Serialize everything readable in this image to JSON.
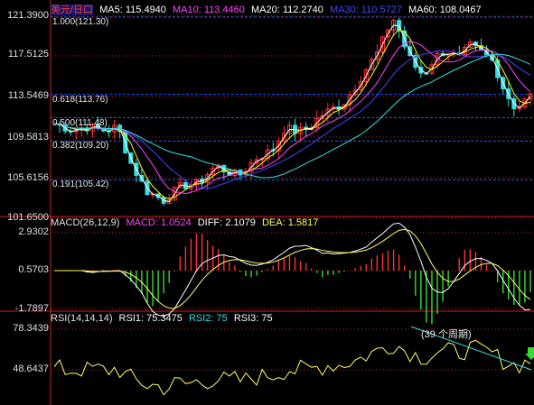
{
  "main_panel": {
    "legend": {
      "symbol": "美元/日口",
      "ma5": "MA5: 115.4940",
      "ma10": "MA10: 113.4460",
      "ma20": "MA20: 112.2740",
      "ma30": "MA30: 110.5727",
      "ma60": "MA60: 108.0467"
    },
    "y_ticks": [
      "121.3900",
      "117.5125",
      "113.5469",
      "109.5813",
      "105.6156",
      "101.6500"
    ],
    "y_tick_values": [
      121.39,
      117.5125,
      113.5469,
      109.5813,
      105.6156,
      101.65
    ],
    "fib_levels": [
      {
        "label": "1.000(121.30)",
        "value": 121.3
      },
      {
        "label": "0.618(113.76)",
        "value": 113.76
      },
      {
        "label": "0.500(111.48)",
        "value": 111.48
      },
      {
        "label": "0.382(109.20)",
        "value": 109.2
      },
      {
        "label": "0.191(105.42)",
        "value": 105.42
      }
    ]
  },
  "macd_panel": {
    "legend": {
      "name": "MACD(26,12,9)",
      "macd": "MACD: 1.0524",
      "diff": "DIFF: 2.1079",
      "dea": "DEA: 1.5817"
    },
    "y_ticks": [
      "2.9302",
      "0.5703",
      "-1.7897"
    ]
  },
  "rsi_panel": {
    "legend": {
      "name": "RSI(14,14,14)",
      "rsi1": "RSI1: 75.3475",
      "rsi2": "RSI2: 75",
      "rsi3": "RSI3: 75"
    },
    "y_ticks": [
      "78.3439",
      "48.6437"
    ],
    "annotation": "(39 个周期)"
  },
  "colors": {
    "up": "#ff3333",
    "down": "#33e0e0",
    "ma5": "#ffffff",
    "ma10": "#ffff00",
    "ma20": "#ff44ff",
    "ma30": "#4444ff",
    "ma60": "#33e0e0",
    "grid": "#cc2222",
    "fib": "#2255ff",
    "macd_pos": "#ff3333",
    "macd_neg": "#33dd33",
    "rsi_line": "#ffff66",
    "arrow": "#33dd33"
  }
}
